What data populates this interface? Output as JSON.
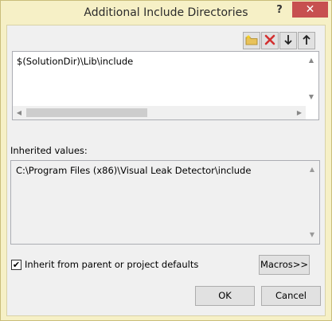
{
  "window": {
    "title": "Additional Include Directories",
    "help_label": "?",
    "close_label": "✕"
  },
  "toolbar": {
    "icons": [
      "new-folder-icon",
      "delete-icon",
      "move-down-icon",
      "move-up-icon"
    ]
  },
  "list": {
    "items": [
      "$(SolutionDir)\\Lib\\include"
    ]
  },
  "inherited": {
    "label": "Inherited values:",
    "items": [
      "C:\\Program Files (x86)\\Visual Leak Detector\\include"
    ]
  },
  "options": {
    "inherit_label": "Inherit from parent or project defaults",
    "inherit_checked": true
  },
  "buttons": {
    "macros": "Macros>>",
    "ok": "OK",
    "cancel": "Cancel"
  },
  "colors": {
    "frame": "#f6f0c6",
    "close": "#c75050",
    "delete_icon": "#d33030"
  }
}
